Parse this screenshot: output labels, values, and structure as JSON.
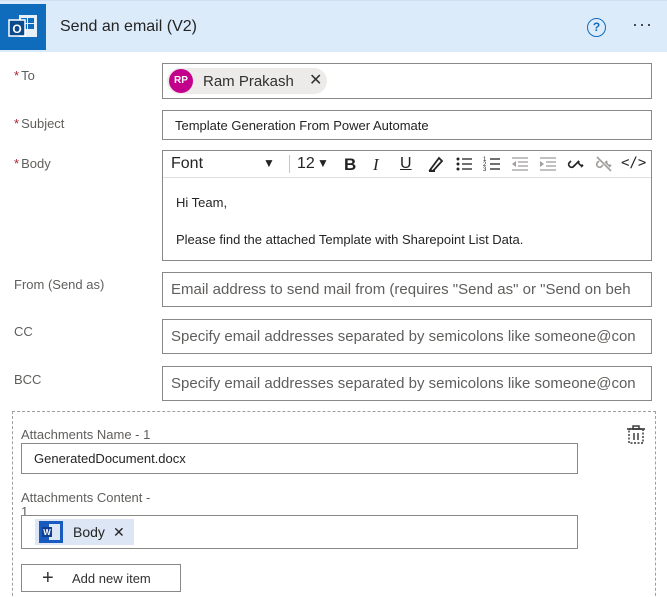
{
  "header": {
    "title": "Send an email (V2)"
  },
  "fields": {
    "to": {
      "label": "To",
      "recipient": {
        "initials": "RP",
        "name": "Ram Prakash"
      }
    },
    "subject": {
      "label": "Subject",
      "value": "Template Generation From Power Automate"
    },
    "body": {
      "label": "Body",
      "toolbar": {
        "font": "Font",
        "size": "12"
      },
      "lines": [
        "Hi Team,",
        "Please find the attached Template with Sharepoint List Data."
      ]
    },
    "from": {
      "label": "From (Send as)",
      "placeholder": "Email address to send mail from (requires \"Send as\" or \"Send on beh"
    },
    "cc": {
      "label": "CC",
      "placeholder": "Specify email addresses separated by semicolons like someone@con"
    },
    "bcc": {
      "label": "BCC",
      "placeholder": "Specify email addresses separated by semicolons like someone@con"
    }
  },
  "attachments": {
    "name_label": "Attachments Name - 1",
    "name_value": "GeneratedDocument.docx",
    "content_label": "Attachments Content -",
    "content_label_2": "1",
    "content_token": "Body",
    "add_label": "Add new item"
  },
  "colors": {
    "accent": "#0f6cbd",
    "header_bg": "#dcebfa",
    "required": "#a4262c",
    "avatar": "#c3008c",
    "word": "#185abd"
  }
}
